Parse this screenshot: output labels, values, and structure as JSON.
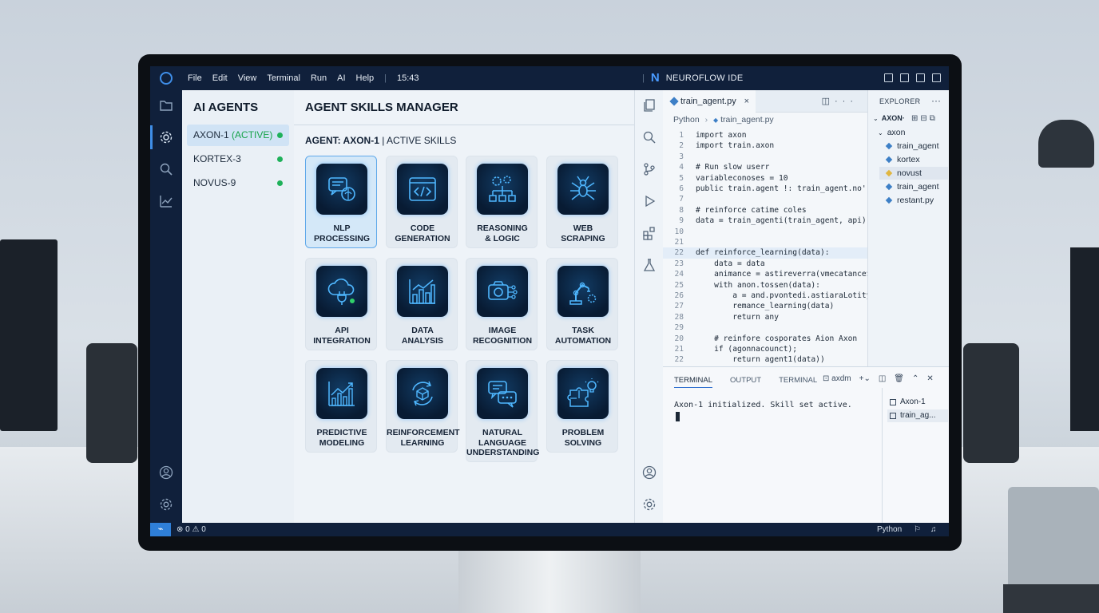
{
  "menu": {
    "items": [
      "File",
      "Edit",
      "View",
      "Terminal",
      "Run",
      "AI",
      "Help"
    ],
    "clock": "15:43",
    "brand_mark": "N",
    "brand": "NEUROFLOW IDE"
  },
  "agents": {
    "title": "AI AGENTS",
    "items": [
      {
        "name": "AXON-1",
        "status": "(ACTIVE)"
      },
      {
        "name": "KORTEX-3",
        "status": ""
      },
      {
        "name": "NOVUS-9",
        "status": ""
      }
    ]
  },
  "skills": {
    "title": "AGENT SKILLS MANAGER",
    "agent_label": "AGENT: AXON-1",
    "active_label": "| ACTIVE SKILLS",
    "cards": [
      {
        "label": "NLP\nPROCESSING",
        "icon": "brain-chat-icon"
      },
      {
        "label": "CODE\nGENERATION",
        "icon": "code-window-icon"
      },
      {
        "label": "REASONING\n& LOGIC",
        "icon": "gears-flowchart-icon"
      },
      {
        "label": "WEB\nSCRAPING",
        "icon": "spider-icon"
      },
      {
        "label": "API\nINTEGRATION",
        "icon": "cloud-plug-icon"
      },
      {
        "label": "DATA\nANALYSIS",
        "icon": "bar-chart-icon"
      },
      {
        "label": "IMAGE\nRECOGNITION",
        "icon": "camera-nodes-icon"
      },
      {
        "label": "TASK\nAUTOMATION",
        "icon": "robot-arm-icon"
      },
      {
        "label": "PREDICTIVE\nMODELING",
        "icon": "trend-chart-icon"
      },
      {
        "label": "REINFORCEMENT\nLEARNING",
        "icon": "cycle-cube-icon"
      },
      {
        "label": "NATURAL\nLANGUAGE\nUNDERSTANDING",
        "icon": "speech-bubbles-icon"
      },
      {
        "label": "PROBLEM\nSOLVING",
        "icon": "puzzle-bulb-icon"
      }
    ]
  },
  "editor": {
    "tab": "train_agent.py",
    "tab_close": "×",
    "breadcrumb_lang": "Python",
    "breadcrumb_file": "train_agent.py",
    "lines": [
      {
        "n": "1",
        "t": "import axon"
      },
      {
        "n": "2",
        "t": "import train.axon"
      },
      {
        "n": "3",
        "t": ""
      },
      {
        "n": "4",
        "t": "# Run slow userr"
      },
      {
        "n": "5",
        "t": "variableconoses = 10"
      },
      {
        "n": "6",
        "t": "public train.agent !: train_agent.no'()"
      },
      {
        "n": "7",
        "t": ""
      },
      {
        "n": "8",
        "t": "# reinforce catime coles"
      },
      {
        "n": "9",
        "t": "data = train_agenti(train_agent, api))"
      },
      {
        "n": "10",
        "t": ""
      },
      {
        "n": "21",
        "t": ""
      },
      {
        "n": "22",
        "t": "def reinforce_learning(data):"
      },
      {
        "n": "23",
        "t": "    data = data"
      },
      {
        "n": "24",
        "t": "    animance = astireverra(vmecatance$"
      },
      {
        "n": "25",
        "t": "    with anon.tossen(data):"
      },
      {
        "n": "26",
        "t": "        a = and.pvontedi.astiaraLotity"
      },
      {
        "n": "27",
        "t": "        remance_learning(data)"
      },
      {
        "n": "28",
        "t": "        return any"
      },
      {
        "n": "29",
        "t": ""
      },
      {
        "n": "20",
        "t": "    # reinfore cosporates Aion Axon"
      },
      {
        "n": "21",
        "t": "    if (agonnacounct);"
      },
      {
        "n": "22",
        "t": "        return agent1(data))"
      }
    ]
  },
  "explorer": {
    "title": "EXPLORER",
    "more": "···",
    "workspace": "AXON·",
    "folder": "axon",
    "files": [
      "train_agent",
      "kortex",
      "novust",
      "train_agent",
      "restant.py"
    ]
  },
  "terminal": {
    "tabs": [
      "TERMINAL",
      "OUTPUT",
      "TERMINAL"
    ],
    "shell": "axdm",
    "output": "Axon-1 initialized. Skill set active.",
    "sessions": [
      "Axon-1",
      "train_ag..."
    ]
  },
  "statusbar": {
    "remote": "⌁",
    "problems": "⊗ 0 ⚠ 0",
    "language": "Python"
  }
}
